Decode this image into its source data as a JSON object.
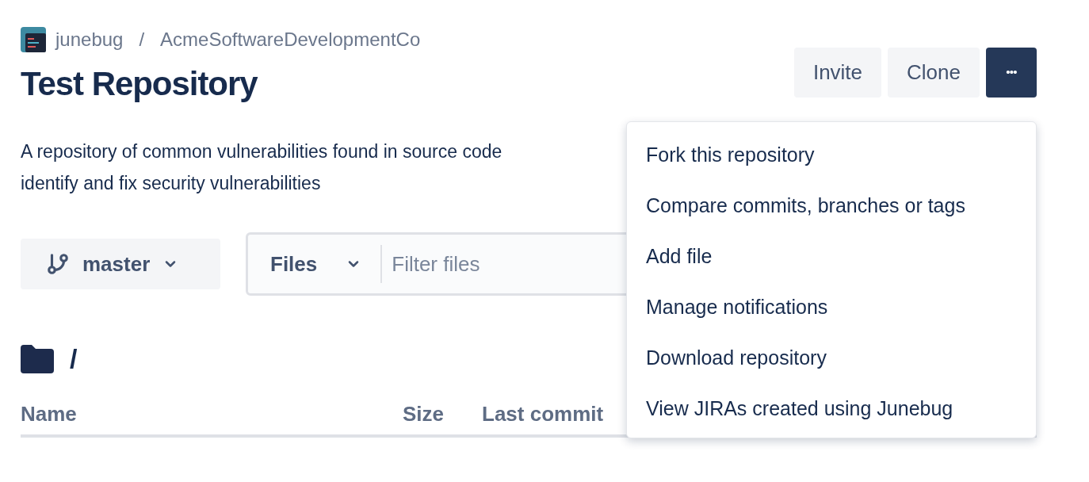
{
  "breadcrumb": {
    "workspace": "junebug",
    "separator": "/",
    "project": "AcmeSoftwareDevelopmentCo"
  },
  "title": "Test Repository",
  "actions": [
    {
      "kind": "text",
      "label": "Invite"
    },
    {
      "kind": "text",
      "label": "Clone"
    },
    {
      "kind": "more",
      "label": "•••",
      "selected": true
    }
  ],
  "description": [
    "A repository of common vulnerabilities found in source code",
    "identify and fix security vulnerabilities"
  ],
  "branch": {
    "label": "master"
  },
  "filter": {
    "scope": "Files",
    "placeholder": "Filter files"
  },
  "path": "/",
  "table": {
    "columns": [
      "Name",
      "Size",
      "Last commit"
    ]
  },
  "menu": {
    "items": [
      "Fork this repository",
      "Compare commits, branches or tags",
      "Add file",
      "Manage notifications",
      "Download repository",
      "View JIRAs created using Junebug"
    ]
  }
}
